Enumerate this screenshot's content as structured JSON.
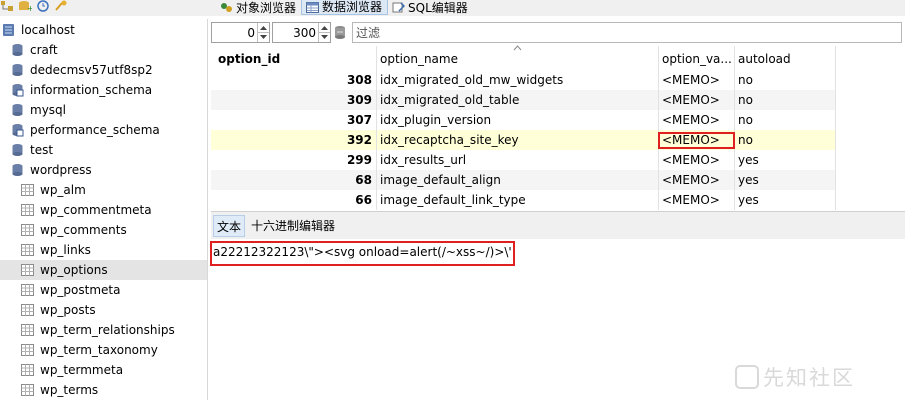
{
  "toolbar": {
    "tabs": [
      {
        "label": "对象浏览器",
        "icon": "object-browser-icon",
        "active": false
      },
      {
        "label": "数据浏览器",
        "icon": "data-browser-icon",
        "active": true
      },
      {
        "label": "SQL编辑器",
        "icon": "sql-editor-icon",
        "active": false
      }
    ]
  },
  "tree": {
    "root": "localhost",
    "databases": [
      "craft",
      "dedecmsv57utf8sp2",
      "information_schema",
      "mysql",
      "performance_schema",
      "test",
      "wordpress"
    ],
    "tables": [
      "wp_alm",
      "wp_commentmeta",
      "wp_comments",
      "wp_links",
      "wp_options",
      "wp_postmeta",
      "wp_posts",
      "wp_term_relationships",
      "wp_term_taxonomy",
      "wp_termmeta",
      "wp_terms"
    ],
    "selected": "wp_options"
  },
  "filter": {
    "offset": "0",
    "limit": "300",
    "placeholder": "过滤"
  },
  "grid": {
    "columns": [
      "option_id",
      "option_name",
      "option_va...",
      "autoload"
    ],
    "rows": [
      {
        "id": "308",
        "name": "idx_migrated_old_mw_widgets",
        "value": "<MEMO>",
        "autoload": "no"
      },
      {
        "id": "309",
        "name": "idx_migrated_old_table",
        "value": "<MEMO>",
        "autoload": "no"
      },
      {
        "id": "307",
        "name": "idx_plugin_version",
        "value": "<MEMO>",
        "autoload": "no"
      },
      {
        "id": "392",
        "name": "idx_recaptcha_site_key",
        "value": "<MEMO>",
        "autoload": "no"
      },
      {
        "id": "299",
        "name": "idx_results_url",
        "value": "<MEMO>",
        "autoload": "yes"
      },
      {
        "id": "68",
        "name": "image_default_align",
        "value": "<MEMO>",
        "autoload": "yes"
      },
      {
        "id": "66",
        "name": "image_default_link_type",
        "value": "<MEMO>",
        "autoload": "yes"
      }
    ],
    "selected_row": 3
  },
  "bottom_tabs": [
    "文本",
    "十六进制编辑器"
  ],
  "editor": {
    "content": "a22212322123\\\"><svg onload=alert(/~xss~/)>\\'"
  },
  "watermark": "先知社区",
  "colors": {
    "highlight_row": "#ffffd8",
    "red_box": "#e02020",
    "selection": "#e4e4e4"
  }
}
